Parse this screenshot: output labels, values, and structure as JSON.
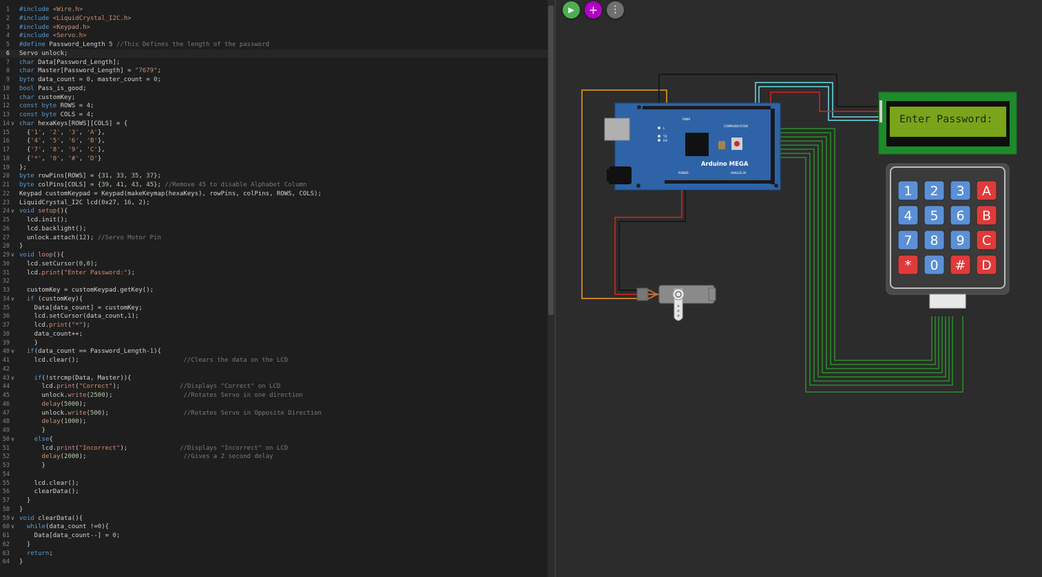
{
  "editor": {
    "active_line": 6,
    "lines": [
      {
        "n": "1",
        "fold": "",
        "code": "#include <Wire.h>"
      },
      {
        "n": "2",
        "fold": "",
        "code": "#include <LiquidCrystal_I2C.h>"
      },
      {
        "n": "3",
        "fold": "",
        "code": "#include <Keypad.h>"
      },
      {
        "n": "4",
        "fold": "",
        "code": "#include <Servo.h>"
      },
      {
        "n": "5",
        "fold": "",
        "code": "#define Password_Length 5 //This Defines the length of the password"
      },
      {
        "n": "6",
        "fold": "",
        "code": "Servo unlock;"
      },
      {
        "n": "7",
        "fold": "",
        "code": "char Data[Password_Length];"
      },
      {
        "n": "8",
        "fold": "",
        "code": "char Master[Password_Length] = \"7679\";"
      },
      {
        "n": "9",
        "fold": "",
        "code": "byte data_count = 0, master_count = 0;"
      },
      {
        "n": "10",
        "fold": "",
        "code": "bool Pass_is_good;"
      },
      {
        "n": "11",
        "fold": "",
        "code": "char customKey;"
      },
      {
        "n": "12",
        "fold": "",
        "code": "const byte ROWS = 4;"
      },
      {
        "n": "13",
        "fold": "",
        "code": "const byte COLS = 4;"
      },
      {
        "n": "14",
        "fold": "∨",
        "code": "char hexaKeys[ROWS][COLS] = {"
      },
      {
        "n": "15",
        "fold": "",
        "code": "  {'1', '2', '3', 'A'},"
      },
      {
        "n": "16",
        "fold": "",
        "code": "  {'4', '5', '6', 'B'},"
      },
      {
        "n": "17",
        "fold": "",
        "code": "  {'7', '8', '9', 'C'},"
      },
      {
        "n": "18",
        "fold": "",
        "code": "  {'*', '0', '#', 'D'}"
      },
      {
        "n": "19",
        "fold": "",
        "code": "};"
      },
      {
        "n": "20",
        "fold": "",
        "code": "byte rowPins[ROWS] = {31, 33, 35, 37};"
      },
      {
        "n": "21",
        "fold": "",
        "code": "byte colPins[COLS] = {39, 41, 43, 45}; //Remove 45 to disable Alphabet Column"
      },
      {
        "n": "22",
        "fold": "",
        "code": "Keypad customKeypad = Keypad(makeKeymap(hexaKeys), rowPins, colPins, ROWS, COLS);"
      },
      {
        "n": "23",
        "fold": "",
        "code": "LiquidCrystal_I2C lcd(0x27, 16, 2);"
      },
      {
        "n": "24",
        "fold": "∨",
        "code": "void setup(){"
      },
      {
        "n": "25",
        "fold": "",
        "code": "  lcd.init();"
      },
      {
        "n": "26",
        "fold": "",
        "code": "  lcd.backlight();"
      },
      {
        "n": "27",
        "fold": "",
        "code": "  unlock.attach(12); //Servo Motor Pin"
      },
      {
        "n": "28",
        "fold": "",
        "code": "}"
      },
      {
        "n": "29",
        "fold": "∨",
        "code": "void loop(){"
      },
      {
        "n": "30",
        "fold": "",
        "code": "  lcd.setCursor(0,0);"
      },
      {
        "n": "31",
        "fold": "",
        "code": "  lcd.print(\"Enter Password:\");"
      },
      {
        "n": "32",
        "fold": "",
        "code": ""
      },
      {
        "n": "33",
        "fold": "",
        "code": "  customKey = customKeypad.getKey();"
      },
      {
        "n": "34",
        "fold": "∨",
        "code": "  if (customKey){"
      },
      {
        "n": "35",
        "fold": "",
        "code": "    Data[data_count] = customKey;"
      },
      {
        "n": "36",
        "fold": "",
        "code": "    lcd.setCursor(data_count,1);"
      },
      {
        "n": "37",
        "fold": "",
        "code": "    lcd.print(\"*\");"
      },
      {
        "n": "38",
        "fold": "",
        "code": "    data_count++;"
      },
      {
        "n": "39",
        "fold": "",
        "code": "    }"
      },
      {
        "n": "40",
        "fold": "∨",
        "code": "  if(data_count == Password_Length-1){"
      },
      {
        "n": "41",
        "fold": "",
        "code": "    lcd.clear();                            //Clears the data on the LCD"
      },
      {
        "n": "42",
        "fold": "",
        "code": ""
      },
      {
        "n": "43",
        "fold": "∨",
        "code": "    if(!strcmp(Data, Master)){"
      },
      {
        "n": "44",
        "fold": "",
        "code": "      lcd.print(\"Correct\");                //Displays \"Correct\" on LCD"
      },
      {
        "n": "45",
        "fold": "",
        "code": "      unlock.write(2500);                   //Rotates Servo in one direction"
      },
      {
        "n": "46",
        "fold": "",
        "code": "      delay(5000);"
      },
      {
        "n": "47",
        "fold": "",
        "code": "      unlock.write(500);                    //Rotates Servo in Opposite Direction"
      },
      {
        "n": "48",
        "fold": "",
        "code": "      delay(1000);"
      },
      {
        "n": "49",
        "fold": "",
        "code": "      }"
      },
      {
        "n": "50",
        "fold": "∨",
        "code": "    else{"
      },
      {
        "n": "51",
        "fold": "",
        "code": "      lcd.print(\"Incorrect\");              //Displays \"Incorrect\" on LCD"
      },
      {
        "n": "52",
        "fold": "",
        "code": "      delay(2000);                          //Gives a 2 second delay"
      },
      {
        "n": "53",
        "fold": "",
        "code": "      }"
      },
      {
        "n": "54",
        "fold": "",
        "code": ""
      },
      {
        "n": "55",
        "fold": "",
        "code": "    lcd.clear();"
      },
      {
        "n": "56",
        "fold": "",
        "code": "    clearData();"
      },
      {
        "n": "57",
        "fold": "",
        "code": "  }"
      },
      {
        "n": "58",
        "fold": "",
        "code": "}"
      },
      {
        "n": "59",
        "fold": "∨",
        "code": "void clearData(){"
      },
      {
        "n": "60",
        "fold": "∨",
        "code": "  while(data_count !=0){"
      },
      {
        "n": "61",
        "fold": "",
        "code": "    Data[data_count--] = 0;"
      },
      {
        "n": "62",
        "fold": "",
        "code": "  }"
      },
      {
        "n": "63",
        "fold": "",
        "code": "  return;"
      },
      {
        "n": "64",
        "fold": "",
        "code": "}"
      }
    ]
  },
  "toolbar": {
    "play": {
      "icon": "play-icon",
      "glyph": "▶",
      "color": "#4caf50"
    },
    "add": {
      "icon": "plus-icon",
      "glyph": "+",
      "color": "#b000c8"
    },
    "more": {
      "icon": "more-vertical-icon",
      "glyph": "⋮",
      "color": "#707070"
    }
  },
  "board": {
    "name": "Arduino MEGA",
    "labels": {
      "pwm": "PWM",
      "communication": "COMMUNICATION",
      "power": "POWER",
      "analog": "ANALOG IN",
      "l": "L",
      "tx": "TX",
      "rx": "RX"
    },
    "color": "#2f63a8"
  },
  "lcd": {
    "text": "Enter Password:",
    "line2": "",
    "color": "#1e8a2b",
    "screen": "#7aa51a"
  },
  "keypad": {
    "keys": [
      [
        "1",
        "2",
        "3",
        "A"
      ],
      [
        "4",
        "5",
        "6",
        "B"
      ],
      [
        "7",
        "8",
        "9",
        "C"
      ],
      [
        "*",
        "0",
        "#",
        "D"
      ]
    ],
    "digit_color": "#5b8fd6",
    "letter_color": "#e03a3a"
  },
  "colors": {
    "editor_bg": "#1e1e1e",
    "sim_bg": "#2c2c2c",
    "keyword": "#569cd6",
    "string": "#ce9178",
    "comment": "#7a7a7a",
    "number": "#b5cea8",
    "function": "#dcdcaa",
    "control": "#c586c0",
    "wire_signal": "#2aa32a",
    "wire_power": "#e02020",
    "wire_ground": "#111111",
    "wire_servo": "#f0a020",
    "wire_i2c": "#6cdcec"
  }
}
